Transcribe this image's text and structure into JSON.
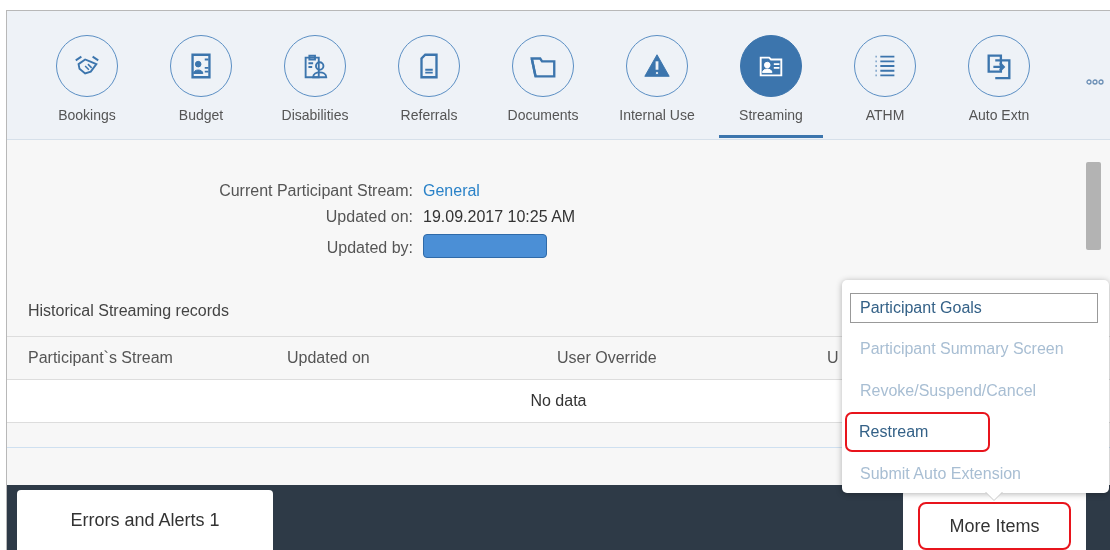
{
  "tabs": [
    {
      "label": "Bookings",
      "selected": false
    },
    {
      "label": "Budget",
      "selected": false
    },
    {
      "label": "Disabilities",
      "selected": false
    },
    {
      "label": "Referrals",
      "selected": false
    },
    {
      "label": "Documents",
      "selected": false
    },
    {
      "label": "Internal Use",
      "selected": false
    },
    {
      "label": "Streaming",
      "selected": true
    },
    {
      "label": "ATHM",
      "selected": false
    },
    {
      "label": "Auto Extn",
      "selected": false
    }
  ],
  "stream_info": [
    {
      "label": "Current Participant Stream:",
      "value": "General",
      "kind": "link"
    },
    {
      "label": "Updated on:",
      "value": "19.09.2017 10:25 AM",
      "kind": "text"
    },
    {
      "label": "Updated by:",
      "kind": "redacted"
    }
  ],
  "history": {
    "title": "Historical Streaming records",
    "columns": [
      "Participant`s Stream",
      "Updated on",
      "User Override",
      "U"
    ],
    "empty_text": "No data"
  },
  "footer": {
    "errors_button": "Errors and Alerts 1",
    "more_button": {
      "label": "More Items",
      "highlighted": true
    }
  },
  "menu": [
    {
      "label": "Participant Goals",
      "focused": true,
      "disabled": false,
      "highlighted": false
    },
    {
      "label": "Participant Summary Screen",
      "focused": false,
      "disabled": true,
      "highlighted": false
    },
    {
      "label": "Revoke/Suspend/Cancel",
      "focused": false,
      "disabled": true,
      "highlighted": false
    },
    {
      "label": "Restream",
      "focused": false,
      "disabled": false,
      "highlighted": true
    },
    {
      "label": "Submit Auto Extension",
      "focused": false,
      "disabled": true,
      "highlighted": false
    }
  ]
}
